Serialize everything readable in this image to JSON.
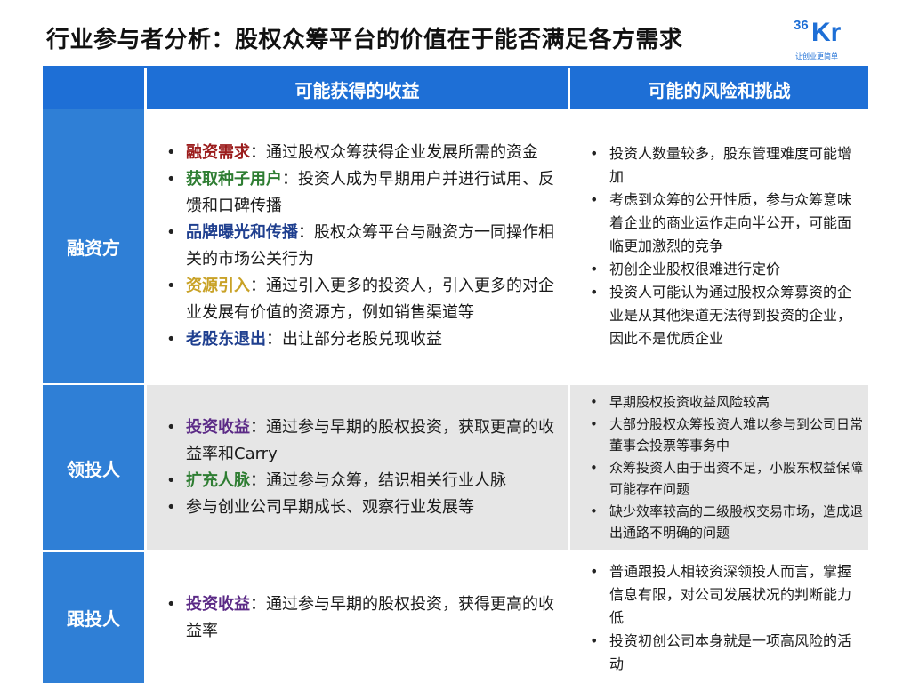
{
  "title": "行业参与者分析：股权众筹平台的价值在于能否满足各方需求",
  "logo": {
    "number": "36",
    "letters": "Kr",
    "slogan": "让创业更简单"
  },
  "colors": {
    "header_blue": "#1e6fd6",
    "label_blue": "#2f7fd6",
    "row_gray": "#e6e6e6"
  },
  "header": {
    "benefits": "可能获得的收益",
    "risks": "可能的风险和挑战"
  },
  "rows": [
    {
      "label": "融资方",
      "benefits": [
        {
          "kw": "融资需求",
          "color": "#9b1c1c",
          "text": "通过股权众筹获得企业发展所需的资金"
        },
        {
          "kw": "获取种子用户",
          "color": "#2e7d32",
          "text": "投资人成为早期用户并进行试用、反馈和口碑传播"
        },
        {
          "kw": "品牌曝光和传播",
          "color": "#1f3f8f",
          "text": "股权众筹平台与融资方一同操作相关的市场公关行为"
        },
        {
          "kw": "资源引入",
          "color": "#c9a227",
          "text": "通过引入更多的投资人，引入更多的对企业发展有价值的资源方，例如销售渠道等"
        },
        {
          "kw": "老股东退出",
          "color": "#1f3f8f",
          "text": "出让部分老股兑现收益"
        }
      ],
      "risks": [
        "投资人数量较多，股东管理难度可能增加",
        "考虑到众筹的公开性质，参与众筹意味着企业的商业运作走向半公开，可能面临更加激烈的竞争",
        "初创企业股权很难进行定价",
        "投资人可能认为通过股权众筹募资的企业是从其他渠道无法得到投资的企业，因此不是优质企业"
      ]
    },
    {
      "label": "领投人",
      "benefits": [
        {
          "kw": "投资收益",
          "color": "#5b2a86",
          "text": "通过参与早期的股权投资，获取更高的收益率和Carry"
        },
        {
          "kw": "扩充人脉",
          "color": "#2e7d32",
          "text": "通过参与众筹，结识相关行业人脉"
        },
        {
          "kw": "",
          "color": "",
          "text": "参与创业公司早期成长、观察行业发展等"
        }
      ],
      "risks": [
        "早期股权投资收益风险较高",
        "大部分股权众筹投资人难以参与到公司日常董事会投票等事务中",
        "众筹投资人由于出资不足，小股东权益保障可能存在问题",
        "缺少效率较高的二级股权交易市场，造成退出通路不明确的问题"
      ]
    },
    {
      "label": "跟投人",
      "benefits": [
        {
          "kw": "投资收益",
          "color": "#5b2a86",
          "text": "通过参与早期的股权投资，获得更高的收益率"
        }
      ],
      "risks": [
        "普通跟投人相较资深领投人而言，掌握信息有限，对公司发展状况的判断能力低",
        "投资初创公司本身就是一项高风险的活动"
      ]
    }
  ]
}
